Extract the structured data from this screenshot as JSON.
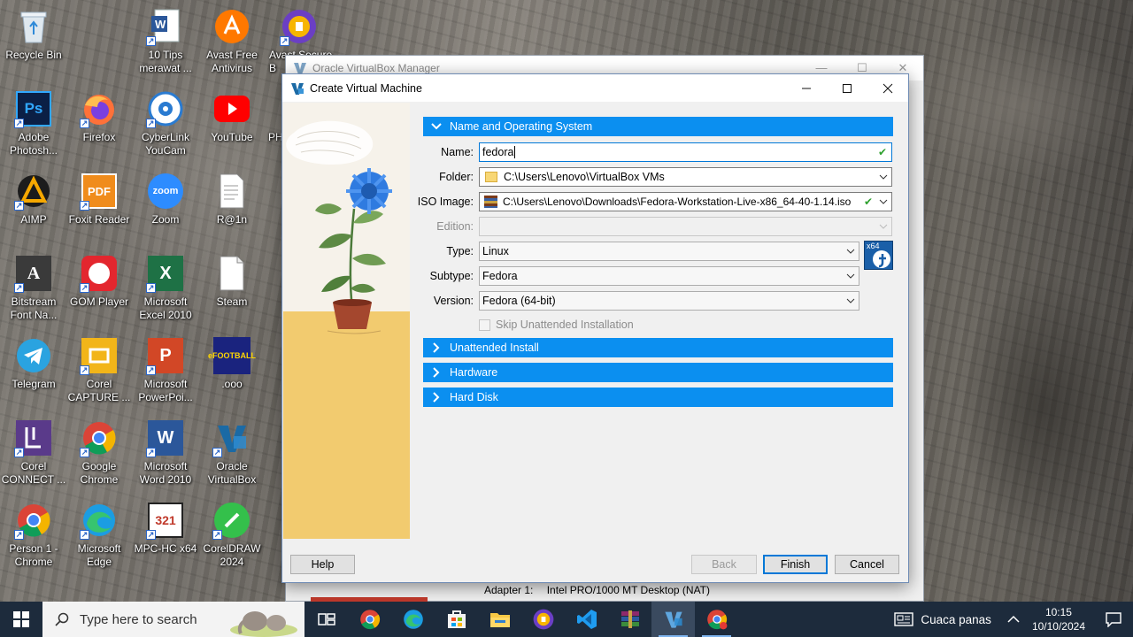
{
  "desktop": {
    "icons": [
      {
        "label": "Recycle Bin",
        "icon": "recycle-bin-icon"
      },
      {
        "label": "10 Tips merawat ...",
        "icon": "word-document-icon"
      },
      {
        "label": "Avast Free Antivirus",
        "icon": "avast-icon"
      },
      {
        "label": "Avast Secure B",
        "icon": "avast-secure-browser-icon"
      },
      {
        "label": "Adobe Photosh...",
        "icon": "photoshop-icon"
      },
      {
        "label": "Firefox",
        "icon": "firefox-icon"
      },
      {
        "label": "CyberLink YouCam",
        "icon": "youcam-icon"
      },
      {
        "label": "YouTube",
        "icon": "youtube-icon"
      },
      {
        "label": "PH",
        "icon": "ph-icon"
      },
      {
        "label": "AIMP",
        "icon": "aimp-icon"
      },
      {
        "label": "Foxit Reader",
        "icon": "foxit-reader-icon"
      },
      {
        "label": "Zoom",
        "icon": "zoom-icon"
      },
      {
        "label": "R@1n",
        "icon": "text-file-icon"
      },
      {
        "label": "Bitstream Font Na...",
        "icon": "bitstream-icon"
      },
      {
        "label": "GOM Player",
        "icon": "gom-player-icon"
      },
      {
        "label": "Microsoft Excel 2010",
        "icon": "excel-icon"
      },
      {
        "label": "Steam",
        "icon": "file-icon"
      },
      {
        "label": "Telegram",
        "icon": "telegram-icon"
      },
      {
        "label": "Corel CAPTURE ...",
        "icon": "corel-capture-icon"
      },
      {
        "label": "Microsoft PowerPoi...",
        "icon": "powerpoint-icon"
      },
      {
        "label": ".ooo",
        "icon": "football-icon"
      },
      {
        "label": "Corel CONNECT ...",
        "icon": "corel-connect-icon"
      },
      {
        "label": "Google Chrome",
        "icon": "chrome-icon"
      },
      {
        "label": "Microsoft Word 2010",
        "icon": "word-icon"
      },
      {
        "label": "Oracle VirtualBox",
        "icon": "virtualbox-icon"
      },
      {
        "label": "Person 1 - Chrome",
        "icon": "chrome-icon"
      },
      {
        "label": "Microsoft Edge",
        "icon": "edge-icon"
      },
      {
        "label": "MPC-HC x64",
        "icon": "mpc-hc-icon"
      },
      {
        "label": "CorelDRAW 2024",
        "icon": "coreldraw-icon"
      }
    ]
  },
  "manager": {
    "title": "Oracle VirtualBox Manager",
    "adapter_label": "Adapter 1:",
    "adapter_value": "Intel PRO/1000 MT Desktop (NAT)"
  },
  "dialog": {
    "title": "Create Virtual Machine",
    "sections": {
      "name_os": "Name and Operating System",
      "unattended": "Unattended Install",
      "hardware": "Hardware",
      "hard_disk": "Hard Disk"
    },
    "fields": {
      "name_label": "Name:",
      "name_value": "fedora",
      "folder_label": "Folder:",
      "folder_value": "C:\\Users\\Lenovo\\VirtualBox VMs",
      "iso_label": "ISO Image:",
      "iso_value": "C:\\Users\\Lenovo\\Downloads\\Fedora-Workstation-Live-x86_64-40-1.14.iso",
      "edition_label": "Edition:",
      "edition_value": "",
      "type_label": "Type:",
      "type_value": "Linux",
      "subtype_label": "Subtype:",
      "subtype_value": "Fedora",
      "version_label": "Version:",
      "version_value": "Fedora (64-bit)",
      "os_badge": "x64",
      "skip_unattended": "Skip Unattended Installation"
    },
    "buttons": {
      "help": "Help",
      "back": "Back",
      "finish": "Finish",
      "cancel": "Cancel"
    }
  },
  "taskbar": {
    "search_placeholder": "Type here to search",
    "apps": [
      "task-view-icon",
      "chrome-icon",
      "edge-icon",
      "store-icon",
      "file-explorer-icon",
      "avast-secure-browser-icon",
      "vscode-icon",
      "winrar-icon",
      "virtualbox-icon",
      "chrome-profile-icon"
    ],
    "weather": "Cuaca panas",
    "time": "10:15",
    "date": "10/10/2024"
  },
  "colors": {
    "section_blue": "#0b8ff0",
    "taskbar": "#1d2b3c",
    "ok_green": "#2ea02e"
  }
}
